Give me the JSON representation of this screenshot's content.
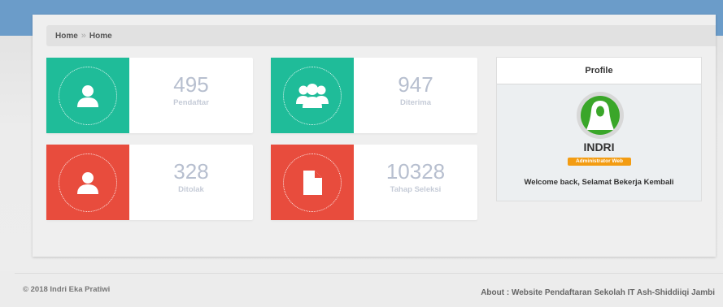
{
  "breadcrumb": {
    "items": [
      "Home",
      "Home"
    ],
    "separator": "»"
  },
  "stats": [
    {
      "value": "495",
      "label": "Pendaftar",
      "color": "#1fbc99",
      "icon": "user-icon"
    },
    {
      "value": "947",
      "label": "Diterima",
      "color": "#1fbc99",
      "icon": "users-group-icon"
    },
    {
      "value": "328",
      "label": "Ditolak",
      "color": "#e84c3d",
      "icon": "user-icon"
    },
    {
      "value": "10328",
      "label": "Tahap Seleksi",
      "color": "#e84c3d",
      "icon": "file-icon"
    }
  ],
  "profile": {
    "title": "Profile",
    "name": "INDRI",
    "role": "Administrator Web",
    "welcome": "Welcome back, Selamat Bekerja Kembali",
    "avatar_icon": "hijab-woman-avatar-icon"
  },
  "footer": {
    "copyright": "© 2018 Indri Eka Pratiwi",
    "about": "About : Website Pendaftaran Sekolah IT Ash-Shiddiiqi Jambi"
  },
  "colors": {
    "topbar": "#6b9cc9",
    "green": "#1fbc99",
    "red": "#e84c3d",
    "badge": "#f39c12",
    "avatar": "#3aa629"
  }
}
